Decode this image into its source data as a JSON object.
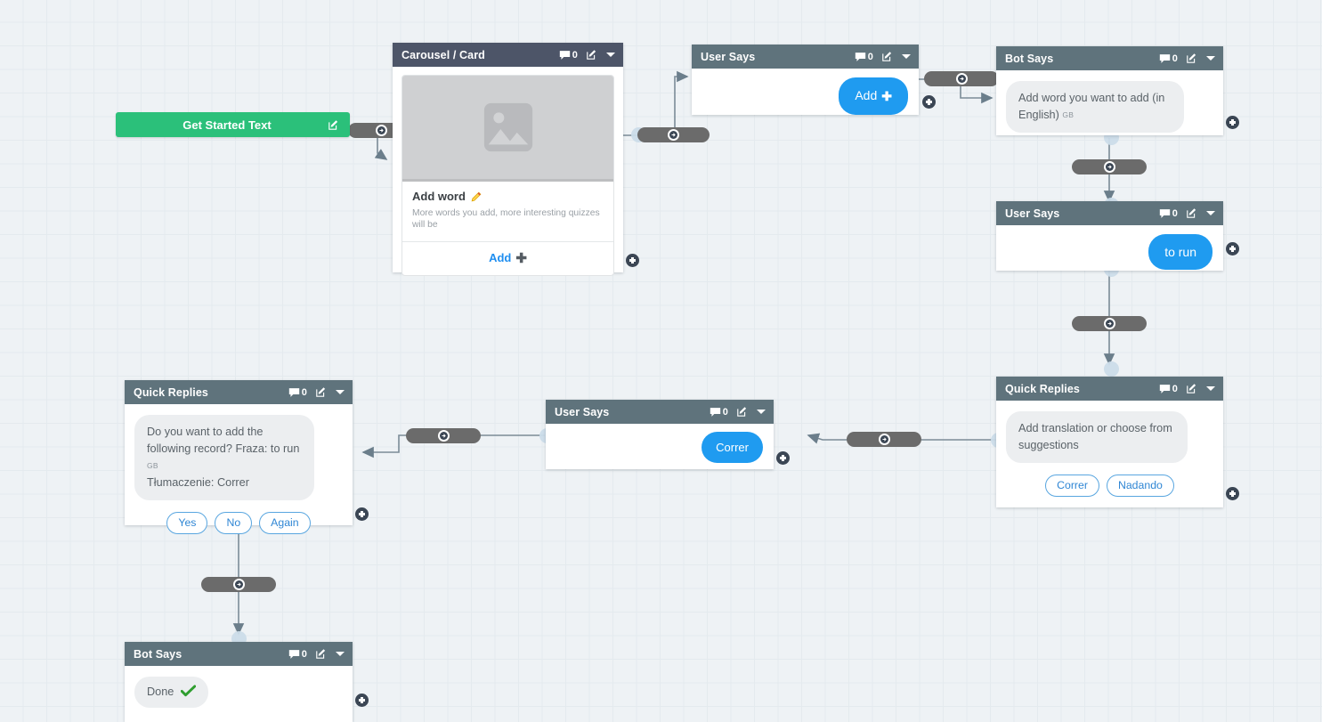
{
  "canvas": {
    "background": "#eef2f5",
    "grid": "#e4eaee"
  },
  "palette": {
    "header_slate": "#4d5568",
    "header_bluegray": "#5f737c",
    "start_green": "#2bc07a",
    "user_bubble_blue": "#1f9bf0",
    "link_blue": "#1f8ef0",
    "connector_gray": "#6b6b6b"
  },
  "start_node": {
    "label": "Get Started Text",
    "edit_icon": "edit-icon"
  },
  "nodes": {
    "carousel": {
      "title": "Carousel / Card",
      "comment_count": "0",
      "card": {
        "image_placeholder": "image-placeholder-icon",
        "title": "Add word",
        "title_icon": "pencil-icon",
        "subtitle": "More words you add, more interesting quizzes will be",
        "footer_label": "Add",
        "footer_icon": "plus-icon"
      }
    },
    "user_says_add": {
      "title": "User Says",
      "comment_count": "0",
      "bubble": "Add",
      "bubble_icon": "plus-icon"
    },
    "bot_says_add_word": {
      "title": "Bot Says",
      "comment_count": "0",
      "bubble": "Add word you want to add (in English)",
      "flag": "GB"
    },
    "user_says_to_run": {
      "title": "User Says",
      "comment_count": "0",
      "bubble": "to run"
    },
    "quick_replies_translation": {
      "title": "Quick Replies",
      "comment_count": "0",
      "bubble": "Add translation or choose from suggestions",
      "chips": [
        "Correr",
        "Nadando"
      ]
    },
    "user_says_correr": {
      "title": "User Says",
      "comment_count": "0",
      "bubble": "Correr"
    },
    "quick_replies_confirm": {
      "title": "Quick Replies",
      "comment_count": "0",
      "bubble_line1": "Do you want to add the following",
      "bubble_line2": "record? Fraza: to run",
      "bubble_flag": "GB",
      "bubble_line3": "Tłumaczenie: Correr",
      "chips": [
        "Yes",
        "No",
        "Again"
      ]
    },
    "bot_says_done": {
      "title": "Bot Says",
      "comment_count": "0",
      "bubble": "Done",
      "bubble_icon": "check-icon"
    }
  }
}
